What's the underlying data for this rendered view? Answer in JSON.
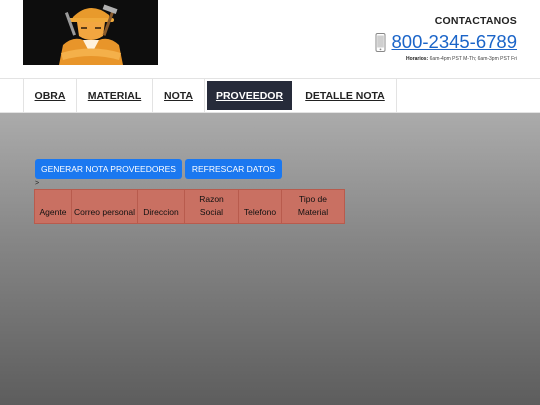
{
  "header": {
    "contact_title": "CONTACTANOS",
    "phone": "800-2345-6789",
    "hours_label": "Horarios:",
    "hours_text": "6am-4pm PST M-Th; 6am-3pm PST Fri",
    "logo_icon": "construction-worker-logo"
  },
  "nav": {
    "items": [
      {
        "label": "OBRA"
      },
      {
        "label": "MATERIAL"
      },
      {
        "label": "NOTA"
      },
      {
        "label": "PROVEEDOR",
        "active": true
      },
      {
        "label": "DETALLE NOTA"
      }
    ]
  },
  "actions": {
    "generate_label": "GENERAR NOTA PROVEEDORES",
    "refresh_label": "REFRESCAR DATOS",
    "caret": ">"
  },
  "table": {
    "columns": [
      "Agente",
      "Correo personal",
      "Direccion",
      "Razon Social",
      "Telefono",
      "Tipo de Material"
    ],
    "rows": []
  },
  "colors": {
    "accent": "#1b78f0",
    "nav_active": "#262b3a",
    "table_header": "#c97062",
    "link": "#1a64c8"
  }
}
